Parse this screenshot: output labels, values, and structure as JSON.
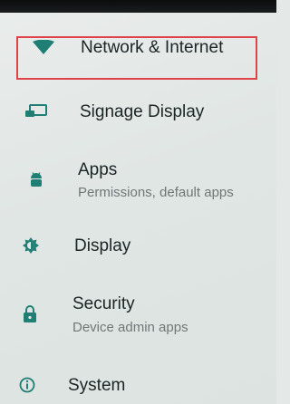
{
  "settings": {
    "items": [
      {
        "title": "Network & Internet",
        "icon": "wifi-icon",
        "highlighted": true
      },
      {
        "title": "Signage Display",
        "icon": "signage-display-icon"
      },
      {
        "title": "Apps",
        "subtitle": "Permissions, default apps",
        "icon": "android-icon"
      },
      {
        "title": "Display",
        "icon": "brightness-icon"
      },
      {
        "title": "Security",
        "subtitle": "Device admin apps",
        "icon": "lock-icon"
      },
      {
        "title": "System",
        "icon": "info-icon"
      }
    ]
  },
  "colors": {
    "accent": "#1f7f74",
    "highlight_border": "#e0424a"
  }
}
